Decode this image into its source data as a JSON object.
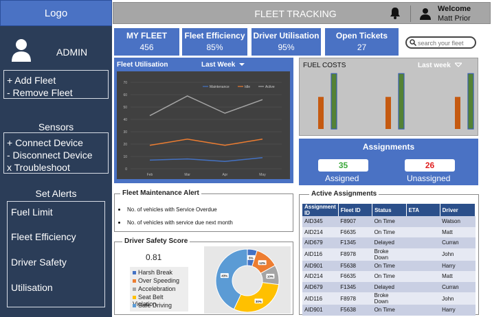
{
  "sidebar": {
    "logo": "Logo",
    "admin_label": "ADMIN",
    "fleet_actions": [
      "+ Add Fleet",
      "- Remove Fleet"
    ],
    "sensors_title": "Sensors",
    "sensor_actions": [
      "+ Connect Device",
      "- Disconnect Device",
      "x Troubleshoot"
    ],
    "alerts_title": "Set Alerts",
    "alert_items": [
      "Fuel Limit",
      "Fleet Efficiency",
      "Driver Safety",
      "Utilisation"
    ]
  },
  "header": {
    "title": "FLEET TRACKING",
    "welcome": "Welcome",
    "user_name": "Matt Prior"
  },
  "kpis": [
    {
      "title": "MY FLEET",
      "value": "456"
    },
    {
      "title": "Fleet Efficiency",
      "value": "85%"
    },
    {
      "title": "Driver Utilisation",
      "value": "95%"
    },
    {
      "title": "Open Tickets",
      "value": "27"
    }
  ],
  "search": {
    "placeholder": "search your fleet"
  },
  "utilisation": {
    "title": "Fleet Utilisation",
    "period": "Last Week"
  },
  "fuel": {
    "title": "FUEL COSTS",
    "period": "Last week"
  },
  "assignments": {
    "title": "Assignments",
    "assigned_value": "35",
    "assigned_label": "Assigned",
    "unassigned_value": "26",
    "unassigned_label": "Unassigned",
    "assigned_color": "#3aa83a",
    "unassigned_color": "#e02020"
  },
  "maintenance": {
    "title": "Fleet Maintenance Alert",
    "items": [
      "No. of vehicles with Service Overdue",
      "No. of vehicles with service due next  month"
    ]
  },
  "safety": {
    "title": "Driver Safety Score",
    "score": "0.81",
    "legend": [
      {
        "label": "Harsh Break",
        "color": "#4472c4"
      },
      {
        "label": "Over Speeding",
        "color": "#ed7d31"
      },
      {
        "label": "Accelebration",
        "color": "#a5a5a5"
      },
      {
        "label": "Seat Belt Violation",
        "color": "#ffc000"
      },
      {
        "label": "Safe Driving",
        "color": "#5b9bd5"
      }
    ]
  },
  "active_assignments": {
    "title": "Active Assignments",
    "columns": [
      "Assignment ID",
      "Fleet ID",
      "Status",
      "ETA",
      "Driver"
    ],
    "rows": [
      [
        "AID345",
        "F8907",
        "On Time",
        "",
        "Watson"
      ],
      [
        "AID214",
        "F6635",
        "On Time",
        "",
        "Matt"
      ],
      [
        "AID679",
        "F1345",
        "Delayed",
        "",
        "Curran"
      ],
      [
        "AID116",
        "F8978",
        "Broke Down",
        "",
        "John"
      ],
      [
        "AID901",
        "F5638",
        "On Time",
        "",
        "Harry"
      ],
      [
        "AID214",
        "F6635",
        "On Time",
        "",
        "Matt"
      ],
      [
        "AID679",
        "F1345",
        "Delayed",
        "",
        "Curran"
      ],
      [
        "AID116",
        "F8978",
        "Broke Down",
        "",
        "John"
      ],
      [
        "AID901",
        "F5638",
        "On Time",
        "",
        "Harry"
      ]
    ]
  },
  "chart_data": [
    {
      "type": "line",
      "categories": [
        "Feb",
        "Mar",
        "Apr",
        "May"
      ],
      "ylim": [
        0,
        70
      ],
      "yticks": [
        "0",
        "10",
        "20",
        "30",
        "40",
        "50",
        "60",
        "70"
      ],
      "grid": true,
      "legend_position": "top-right",
      "series": [
        {
          "name": "Maintenance",
          "color": "#4472c4",
          "values": [
            7,
            8,
            6,
            9
          ]
        },
        {
          "name": "Idle",
          "color": "#ed7d31",
          "values": [
            19,
            24,
            19,
            24
          ]
        },
        {
          "name": "Active",
          "color": "#a5a5a5",
          "values": [
            43,
            59,
            45,
            56
          ]
        }
      ]
    },
    {
      "type": "bar",
      "categories": [
        "1",
        "2",
        "3"
      ],
      "ylim": [
        0,
        100
      ],
      "series": [
        {
          "color": "#c55a11",
          "values": [
            55,
            55,
            55
          ]
        },
        {
          "color": "#548235",
          "values": [
            95,
            95,
            95
          ]
        }
      ]
    },
    {
      "type": "pie",
      "donut": true,
      "slices": [
        {
          "label": "Harsh Break",
          "value": 5,
          "display": "5%",
          "color": "#4472c4"
        },
        {
          "label": "Over Speeding",
          "value": 12,
          "display": "12%",
          "color": "#ed7d31"
        },
        {
          "label": "Accelebration",
          "value": 10,
          "display": "10%",
          "color": "#a5a5a5"
        },
        {
          "label": "Seat Belt Violation",
          "value": 30,
          "display": "30%",
          "color": "#ffc000"
        },
        {
          "label": "Safe Driving",
          "value": 43,
          "display": "43%",
          "color": "#5b9bd5"
        }
      ]
    }
  ]
}
